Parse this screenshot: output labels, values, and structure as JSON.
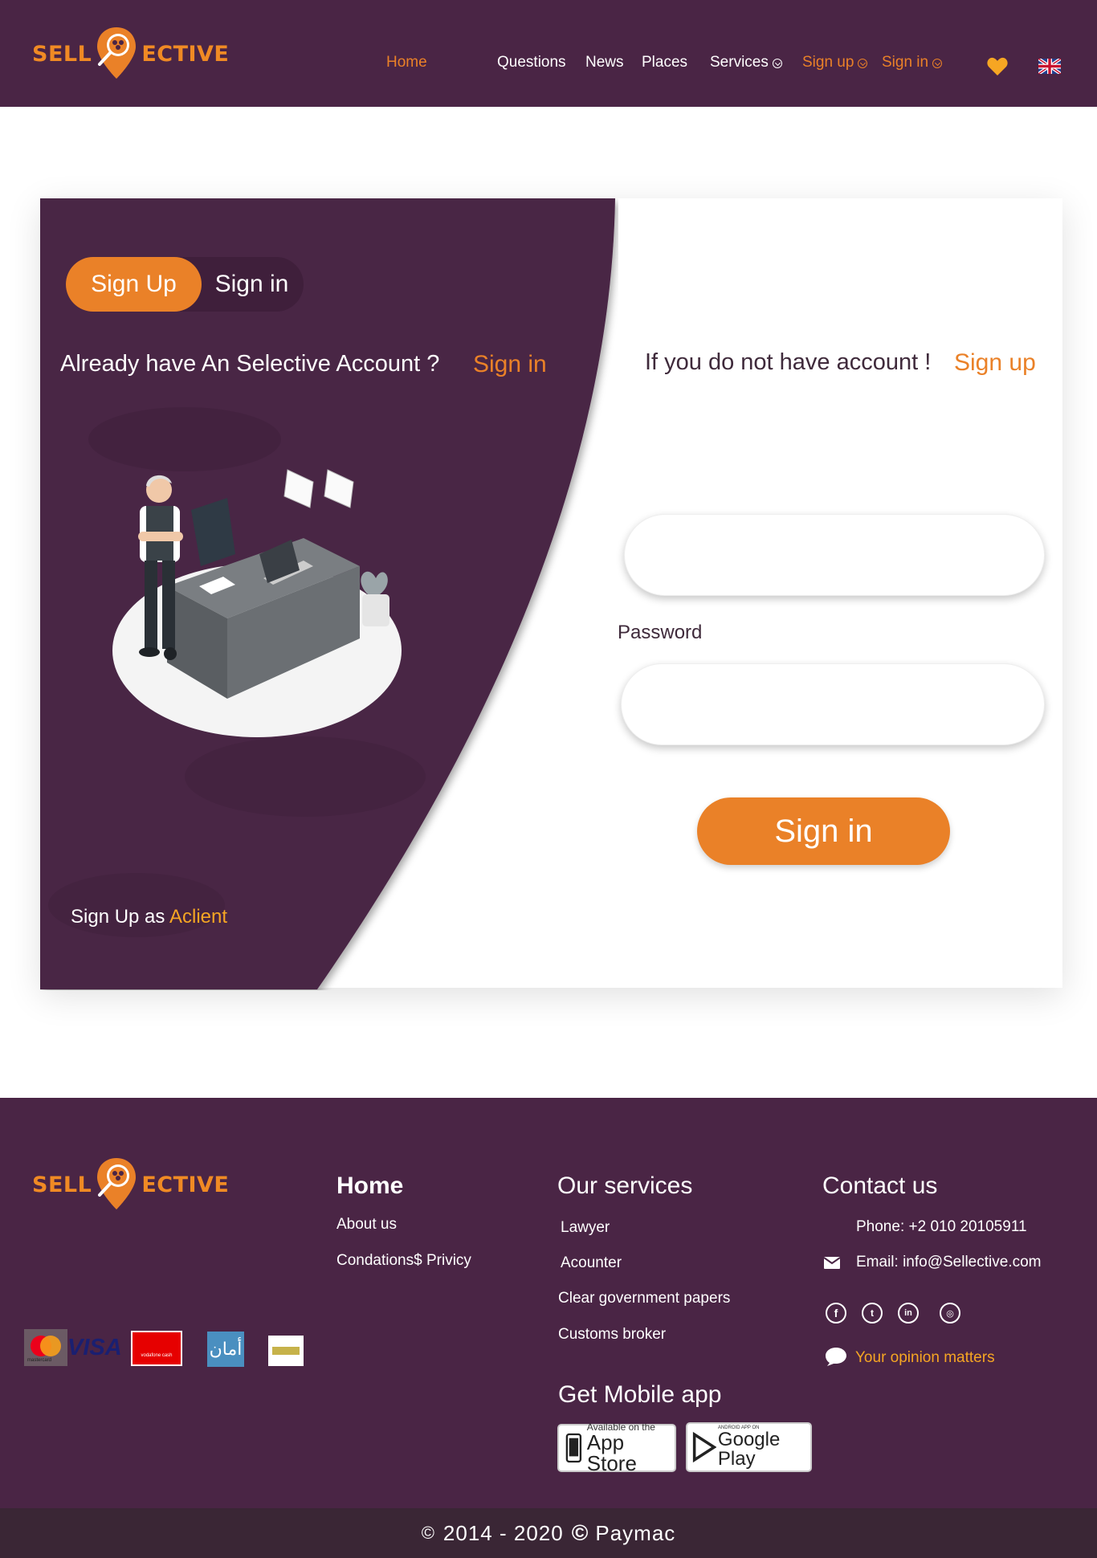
{
  "header": {
    "logo_left": "SELL",
    "logo_right": "ECTIVE",
    "nav": {
      "home": "Home",
      "questions": "Questions",
      "news": "News",
      "places": "Places",
      "services": "Services",
      "signup": "Sign up",
      "signin": "Sign in"
    },
    "icons": [
      "heart-icon",
      "uk-flag-icon"
    ]
  },
  "panel": {
    "toggle_on": "Sign Up",
    "toggle_off": "Sign in",
    "already_text": "Already have An Selective Account ?",
    "already_link": "Sign in",
    "signup_as": "Sign Up as",
    "signup_as_link": "Aclient"
  },
  "form": {
    "no_account_text": "If you do not have account !",
    "no_account_link": "Sign up",
    "username_value": "",
    "password_label": "Password",
    "password_value": "",
    "submit": "Sign in"
  },
  "footer": {
    "logo_left": "SELL",
    "logo_right": "ECTIVE",
    "col1": {
      "title": "Home",
      "links": [
        "About us",
        "Condations$ Privicy"
      ]
    },
    "col2": {
      "title": "Our services",
      "links": [
        "Lawyer",
        "Acounter",
        "Clear government papers",
        "Customs broker"
      ]
    },
    "col3": {
      "title": "Contact us",
      "phone": "Phone: +2 010 20105911",
      "email": "Email: info@Sellective.com",
      "opinion": "Your opinion matters"
    },
    "mobile": {
      "title": "Get Mobile app",
      "appstore_small": "Available on the",
      "appstore_big": "App Store",
      "play_small": "ANDROID APP ON",
      "play_big": "Google Play"
    },
    "payment_logos": {
      "mastercard": "mastercard",
      "visa": "VISA",
      "vodafone": "vodafone cash",
      "aman": "أمان"
    },
    "copyright": "2014 - 2020",
    "copyright_brand": "Paymac"
  },
  "colors": {
    "primary": "#4a2545",
    "accent": "#ea8128",
    "link_yellow": "#f6a623"
  }
}
